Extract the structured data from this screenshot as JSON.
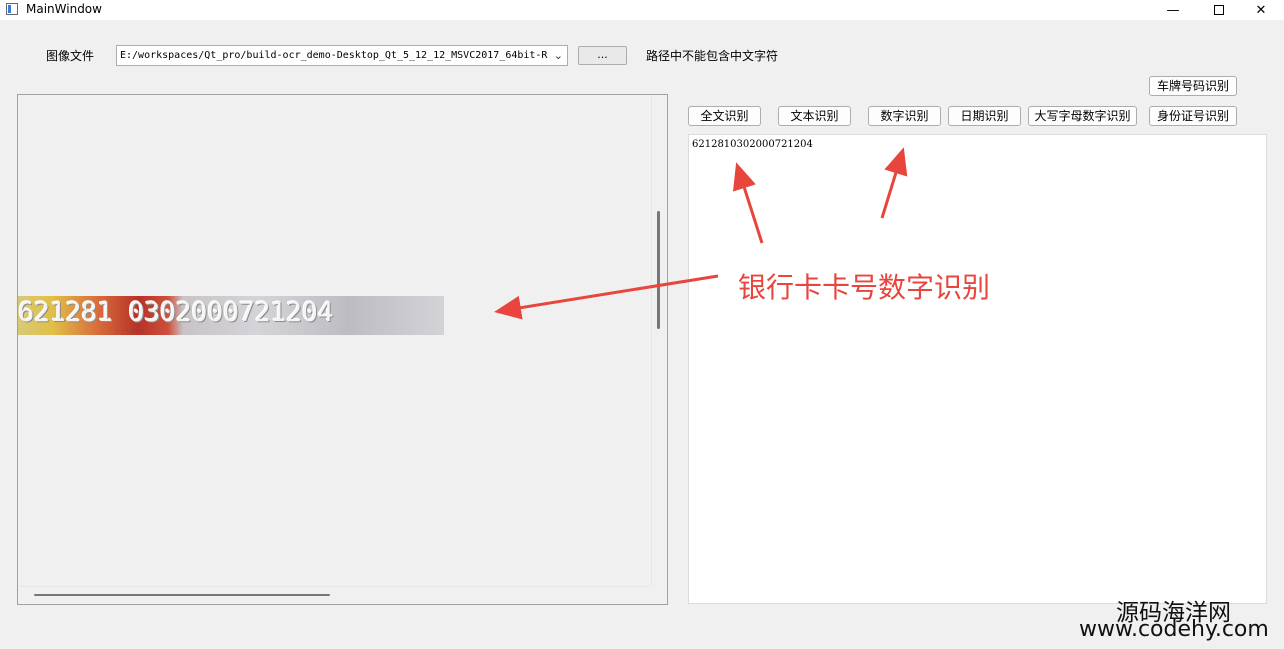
{
  "window": {
    "title": "MainWindow"
  },
  "toolbar": {
    "file_label": "图像文件",
    "path_value": "E:/workspaces/Qt_pro/build-ocr_demo-Desktop_Qt_5_12_12_MSVC2017_64bit-R",
    "browse_label": "...",
    "note": "路径中不能包含中文字符"
  },
  "buttons": {
    "plate": "车牌号码识别",
    "full_text": "全文识别",
    "text": "文本识别",
    "digits": "数字识别",
    "date": "日期识别",
    "upper_digits": "大写字母数字识别",
    "id_card": "身份证号识别"
  },
  "image_preview": {
    "digits": "621281 0302000721204"
  },
  "result": {
    "text": "6212810302000721204"
  },
  "annotation": {
    "text": "银行卡卡号数字识别",
    "color": "#e8453c"
  },
  "watermark": {
    "line1": "源码海洋网",
    "line2": "www.codehy.com"
  }
}
